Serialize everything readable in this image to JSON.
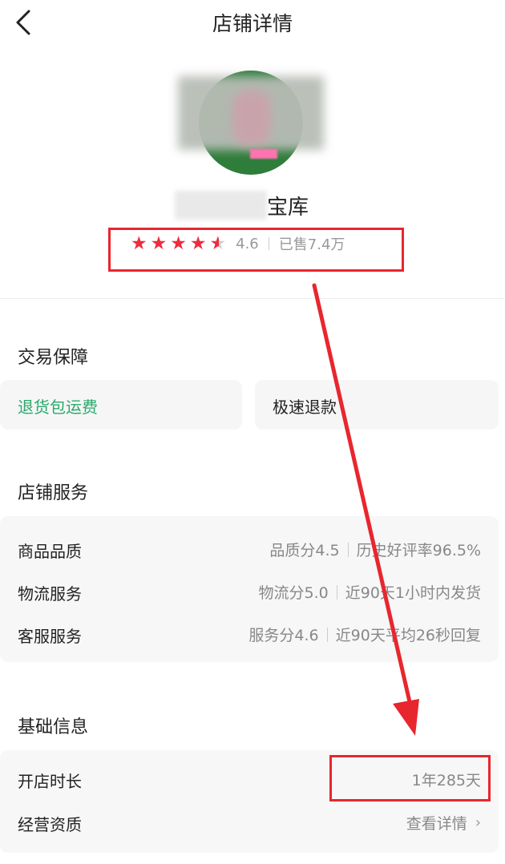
{
  "header": {
    "title": "店铺详情"
  },
  "shop": {
    "name_suffix": "宝库",
    "rating": 4.6,
    "rating_text": "4.6",
    "sold_text": "已售7.4万"
  },
  "trade": {
    "title": "交易保障",
    "chips": [
      {
        "label": "退货包运费",
        "color": "#2aa96b"
      },
      {
        "label": "极速退款",
        "color": "#222222"
      }
    ]
  },
  "service": {
    "title": "店铺服务",
    "rows": [
      {
        "label": "商品品质",
        "metric": "品质分4.5",
        "detail": "历史好评率96.5%"
      },
      {
        "label": "物流服务",
        "metric": "物流分5.0",
        "detail": "近90天1小时内发货"
      },
      {
        "label": "客服服务",
        "metric": "服务分4.6",
        "detail": "近90天平均26秒回复"
      }
    ]
  },
  "basic": {
    "title": "基础信息",
    "rows": [
      {
        "label": "开店时长",
        "value": "1年285天"
      },
      {
        "label": "经营资质",
        "value": "查看详情"
      }
    ]
  },
  "colors": {
    "accent_red": "#e8262e",
    "star": "#ee2c3f",
    "green": "#2aa96b"
  },
  "icons": {
    "back": "chevron-left-icon",
    "star": "star-icon",
    "more": "chevron-right-icon"
  }
}
